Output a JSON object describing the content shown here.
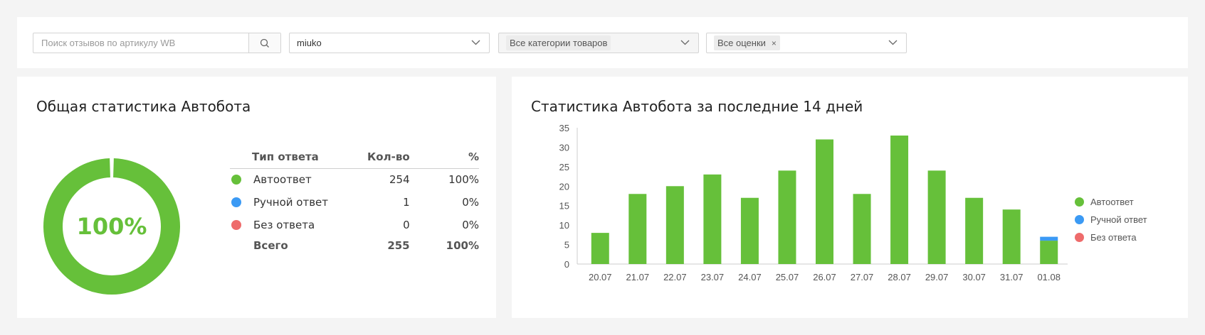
{
  "filters": {
    "search_placeholder": "Поиск отзывов по артикулу WB",
    "search_value": "",
    "store_select": "miuko",
    "category_select": "Все категории товаров",
    "rating_select": "Все оценки",
    "rating_clear": "×",
    "icons": [
      "search-icon",
      "chevron-down-icon",
      "close-icon"
    ]
  },
  "overall": {
    "title": "Общая статистика Автобота",
    "donut_label": "100%",
    "donut_share": 0.996,
    "headers": {
      "type": "Тип ответа",
      "count": "Кол-во",
      "percent": "%"
    },
    "rows": [
      {
        "label": "Автоответ",
        "count": "254",
        "percent": "100%",
        "color": "#66c03a"
      },
      {
        "label": "Ручной ответ",
        "count": "1",
        "percent": "0%",
        "color": "#3b9af4"
      },
      {
        "label": "Без ответа",
        "count": "0",
        "percent": "0%",
        "color": "#ee6b6b"
      }
    ],
    "total": {
      "label": "Всего",
      "count": "255",
      "percent": "100%"
    }
  },
  "recent": {
    "title": "Статистика Автобота за последние 14 дней",
    "legend": [
      {
        "label": "Автоответ",
        "color": "#66c03a"
      },
      {
        "label": "Ручной ответ",
        "color": "#3b9af4"
      },
      {
        "label": "Без ответа",
        "color": "#ee6b6b"
      }
    ]
  },
  "chart_data": {
    "type": "bar",
    "stacked": true,
    "categories": [
      "20.07",
      "21.07",
      "22.07",
      "23.07",
      "24.07",
      "25.07",
      "26.07",
      "27.07",
      "28.07",
      "29.07",
      "30.07",
      "31.07",
      "01.08"
    ],
    "series": [
      {
        "name": "Автоответ",
        "color": "#66c03a",
        "values": [
          8,
          18,
          20,
          23,
          17,
          24,
          32,
          18,
          33,
          24,
          17,
          14,
          6
        ]
      },
      {
        "name": "Ручной ответ",
        "color": "#3b9af4",
        "values": [
          0,
          0,
          0,
          0,
          0,
          0,
          0,
          0,
          0,
          0,
          0,
          0,
          1
        ]
      },
      {
        "name": "Без ответа",
        "color": "#ee6b6b",
        "values": [
          0,
          0,
          0,
          0,
          0,
          0,
          0,
          0,
          0,
          0,
          0,
          0,
          0
        ]
      }
    ],
    "ylim": [
      0,
      35
    ],
    "yticks": [
      0,
      5,
      10,
      15,
      20,
      25,
      30,
      35
    ],
    "grid": false,
    "legend_position": "right"
  }
}
